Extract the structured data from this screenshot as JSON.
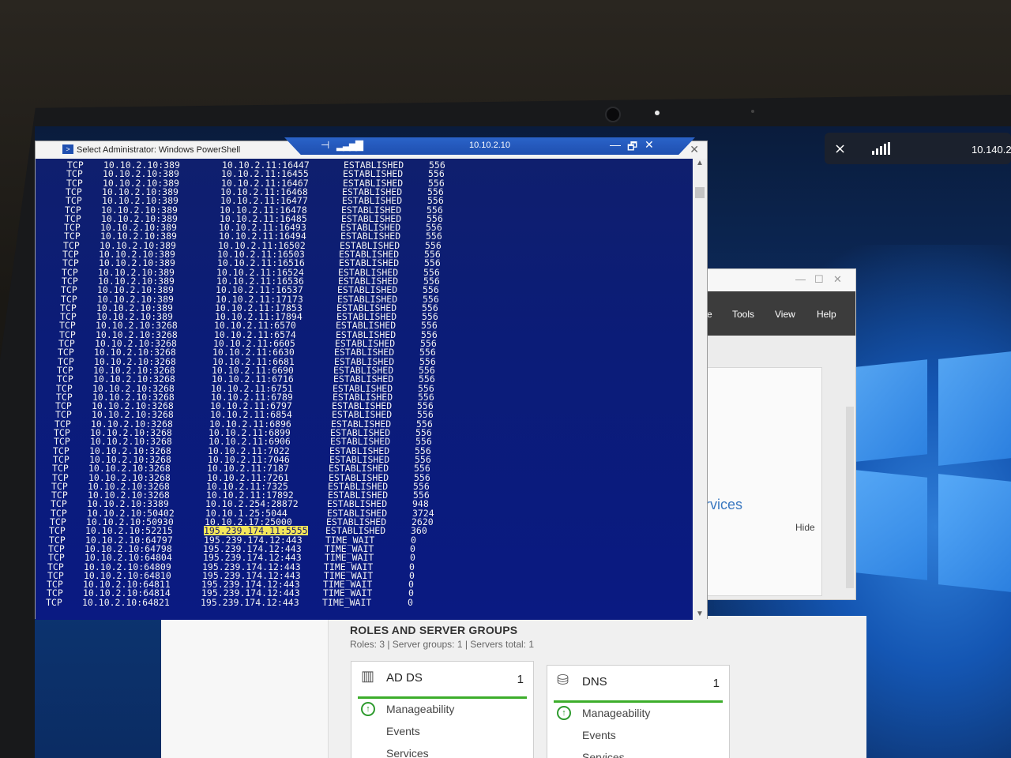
{
  "remote_bar": {
    "host": "10.10.2.10",
    "pin_icon": "pin-icon",
    "signal_icon": "signal-bars-icon",
    "minimize": "—",
    "restore": "🗗",
    "close": "✕"
  },
  "local_tray": {
    "pin_icon": "pin-off-icon",
    "signal_icon": "signal-bars-icon",
    "ip": "10.140.2"
  },
  "powershell": {
    "title": "Select Administrator: Windows PowerShell",
    "close": "✕",
    "rows": [
      [
        "TCP",
        "10.10.2.10:389",
        "10.10.2.11:16447",
        "ESTABLISHED",
        "556"
      ],
      [
        "TCP",
        "10.10.2.10:389",
        "10.10.2.11:16455",
        "ESTABLISHED",
        "556"
      ],
      [
        "TCP",
        "10.10.2.10:389",
        "10.10.2.11:16467",
        "ESTABLISHED",
        "556"
      ],
      [
        "TCP",
        "10.10.2.10:389",
        "10.10.2.11:16468",
        "ESTABLISHED",
        "556"
      ],
      [
        "TCP",
        "10.10.2.10:389",
        "10.10.2.11:16477",
        "ESTABLISHED",
        "556"
      ],
      [
        "TCP",
        "10.10.2.10:389",
        "10.10.2.11:16478",
        "ESTABLISHED",
        "556"
      ],
      [
        "TCP",
        "10.10.2.10:389",
        "10.10.2.11:16485",
        "ESTABLISHED",
        "556"
      ],
      [
        "TCP",
        "10.10.2.10:389",
        "10.10.2.11:16493",
        "ESTABLISHED",
        "556"
      ],
      [
        "TCP",
        "10.10.2.10:389",
        "10.10.2.11:16494",
        "ESTABLISHED",
        "556"
      ],
      [
        "TCP",
        "10.10.2.10:389",
        "10.10.2.11:16502",
        "ESTABLISHED",
        "556"
      ],
      [
        "TCP",
        "10.10.2.10:389",
        "10.10.2.11:16503",
        "ESTABLISHED",
        "556"
      ],
      [
        "TCP",
        "10.10.2.10:389",
        "10.10.2.11:16516",
        "ESTABLISHED",
        "556"
      ],
      [
        "TCP",
        "10.10.2.10:389",
        "10.10.2.11:16524",
        "ESTABLISHED",
        "556"
      ],
      [
        "TCP",
        "10.10.2.10:389",
        "10.10.2.11:16536",
        "ESTABLISHED",
        "556"
      ],
      [
        "TCP",
        "10.10.2.10:389",
        "10.10.2.11:16537",
        "ESTABLISHED",
        "556"
      ],
      [
        "TCP",
        "10.10.2.10:389",
        "10.10.2.11:17173",
        "ESTABLISHED",
        "556"
      ],
      [
        "TCP",
        "10.10.2.10:389",
        "10.10.2.11:17853",
        "ESTABLISHED",
        "556"
      ],
      [
        "TCP",
        "10.10.2.10:389",
        "10.10.2.11:17894",
        "ESTABLISHED",
        "556"
      ],
      [
        "TCP",
        "10.10.2.10:3268",
        "10.10.2.11:6570",
        "ESTABLISHED",
        "556"
      ],
      [
        "TCP",
        "10.10.2.10:3268",
        "10.10.2.11:6574",
        "ESTABLISHED",
        "556"
      ],
      [
        "TCP",
        "10.10.2.10:3268",
        "10.10.2.11:6605",
        "ESTABLISHED",
        "556"
      ],
      [
        "TCP",
        "10.10.2.10:3268",
        "10.10.2.11:6630",
        "ESTABLISHED",
        "556"
      ],
      [
        "TCP",
        "10.10.2.10:3268",
        "10.10.2.11:6681",
        "ESTABLISHED",
        "556"
      ],
      [
        "TCP",
        "10.10.2.10:3268",
        "10.10.2.11:6690",
        "ESTABLISHED",
        "556"
      ],
      [
        "TCP",
        "10.10.2.10:3268",
        "10.10.2.11:6716",
        "ESTABLISHED",
        "556"
      ],
      [
        "TCP",
        "10.10.2.10:3268",
        "10.10.2.11:6751",
        "ESTABLISHED",
        "556"
      ],
      [
        "TCP",
        "10.10.2.10:3268",
        "10.10.2.11:6789",
        "ESTABLISHED",
        "556"
      ],
      [
        "TCP",
        "10.10.2.10:3268",
        "10.10.2.11:6797",
        "ESTABLISHED",
        "556"
      ],
      [
        "TCP",
        "10.10.2.10:3268",
        "10.10.2.11:6854",
        "ESTABLISHED",
        "556"
      ],
      [
        "TCP",
        "10.10.2.10:3268",
        "10.10.2.11:6896",
        "ESTABLISHED",
        "556"
      ],
      [
        "TCP",
        "10.10.2.10:3268",
        "10.10.2.11:6899",
        "ESTABLISHED",
        "556"
      ],
      [
        "TCP",
        "10.10.2.10:3268",
        "10.10.2.11:6906",
        "ESTABLISHED",
        "556"
      ],
      [
        "TCP",
        "10.10.2.10:3268",
        "10.10.2.11:7022",
        "ESTABLISHED",
        "556"
      ],
      [
        "TCP",
        "10.10.2.10:3268",
        "10.10.2.11:7046",
        "ESTABLISHED",
        "556"
      ],
      [
        "TCP",
        "10.10.2.10:3268",
        "10.10.2.11:7187",
        "ESTABLISHED",
        "556"
      ],
      [
        "TCP",
        "10.10.2.10:3268",
        "10.10.2.11:7261",
        "ESTABLISHED",
        "556"
      ],
      [
        "TCP",
        "10.10.2.10:3268",
        "10.10.2.11:7325",
        "ESTABLISHED",
        "556"
      ],
      [
        "TCP",
        "10.10.2.10:3268",
        "10.10.2.11:17892",
        "ESTABLISHED",
        "556"
      ],
      [
        "TCP",
        "10.10.2.10:3389",
        "10.10.2.254:28872",
        "ESTABLISHED",
        "948"
      ],
      [
        "TCP",
        "10.10.2.10:50402",
        "10.10.1.25:5044",
        "ESTABLISHED",
        "3724"
      ],
      [
        "TCP",
        "10.10.2.10:50930",
        "10.10.2.17:25000",
        "ESTABLISHED",
        "2620"
      ],
      [
        "TCP",
        "10.10.2.10:52215",
        "195.239.174.11:5555",
        "ESTABLISHED",
        "360"
      ],
      [
        "TCP",
        "10.10.2.10:64797",
        "195.239.174.12:443",
        "TIME_WAIT",
        "0"
      ],
      [
        "TCP",
        "10.10.2.10:64798",
        "195.239.174.12:443",
        "TIME_WAIT",
        "0"
      ],
      [
        "TCP",
        "10.10.2.10:64804",
        "195.239.174.12:443",
        "TIME_WAIT",
        "0"
      ],
      [
        "TCP",
        "10.10.2.10:64809",
        "195.239.174.12:443",
        "TIME_WAIT",
        "0"
      ],
      [
        "TCP",
        "10.10.2.10:64810",
        "195.239.174.12:443",
        "TIME_WAIT",
        "0"
      ],
      [
        "TCP",
        "10.10.2.10:64811",
        "195.239.174.12:443",
        "TIME_WAIT",
        "0"
      ],
      [
        "TCP",
        "10.10.2.10:64814",
        "195.239.174.12:443",
        "TIME_WAIT",
        "0"
      ],
      [
        "TCP",
        "10.10.2.10:64821",
        "195.239.174.12:443",
        "TIME_WAIT",
        "0"
      ]
    ],
    "highlighted_row": 41,
    "highlight_color": "#f3e65a"
  },
  "server_manager": {
    "window_controls": [
      "—",
      "☐",
      "✕"
    ],
    "menu_partial": "e",
    "menu": [
      "Tools",
      "View",
      "Help"
    ],
    "services_partial": "rvices",
    "hide_label": "Hide",
    "roles_title": "ROLES AND SERVER GROUPS",
    "roles_summary": "Roles: 3   |   Server groups: 1   |   Servers total: 1",
    "tiles": [
      {
        "icon": "ad-ds-icon",
        "name": "AD DS",
        "count": "1",
        "items": [
          "Manageability",
          "Events",
          "Services"
        ]
      },
      {
        "icon": "dns-icon",
        "name": "DNS",
        "count": "1",
        "items": [
          "Manageability",
          "Events",
          "Services"
        ]
      }
    ],
    "status_color": "#3dae2b"
  }
}
